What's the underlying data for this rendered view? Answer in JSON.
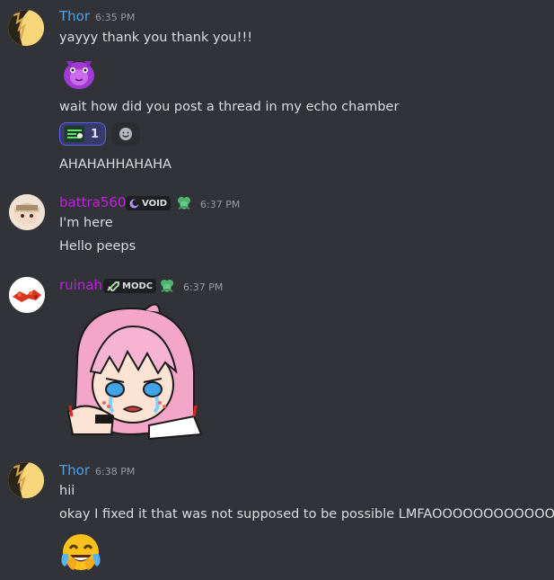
{
  "messages": [
    {
      "author": "Thor",
      "time": "6:35 PM",
      "color": "#4ea2e6",
      "lines": [
        "yayyy thank you thank you!!!",
        "wait how did you post a thread in my echo chamber",
        "AHAHAHHAHAHA"
      ],
      "reactions": [
        {
          "count": "1",
          "active": true
        },
        {
          "count": "",
          "active": false
        }
      ]
    },
    {
      "author": "battra560",
      "time": "6:37 PM",
      "color": "#c41ee6",
      "tag": "VOID",
      "lines": [
        "I'm here",
        "Hello peeps"
      ]
    },
    {
      "author": "ruinah",
      "time": "6:37 PM",
      "color": "#c41ee6",
      "tag": "MODC",
      "lines": []
    },
    {
      "author": "Thor",
      "time": "6:38 PM",
      "color": "#4ea2e6",
      "lines": [
        "hii",
        "okay I fixed it that was not supposed to be possible LMFAOOOOOOOOOOOOO"
      ]
    }
  ],
  "icons": {
    "sticker1": "purple-monster-sticker",
    "sticker2": "crying-anime-girl-sticker",
    "emoji": "face-with-tears-of-joy-icon"
  }
}
